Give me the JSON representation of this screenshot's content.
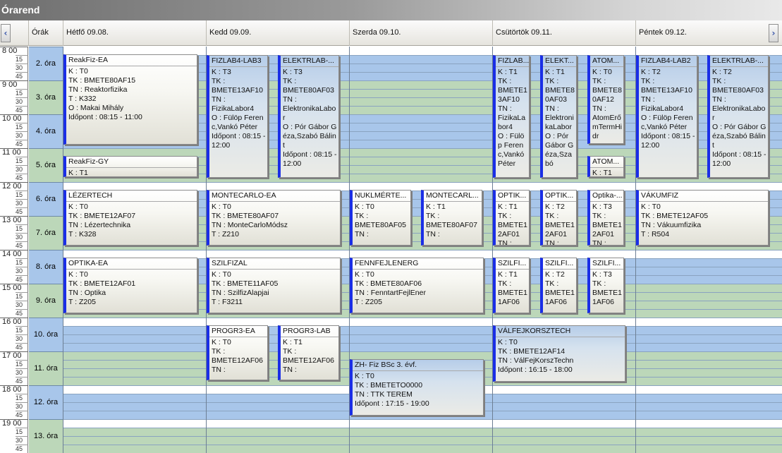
{
  "window": {
    "title": "Órarend"
  },
  "header": {
    "orak_label": "Órák",
    "days": [
      "Hétfő  09.08.",
      "Kedd  09.09.",
      "Szerda  09.10.",
      "Csütörtök  09.11.",
      "Péntek  09.12."
    ],
    "prev_icon": "chevron-left-icon",
    "next_icon": "chevron-right-icon"
  },
  "colors": {
    "blue_band": "#a8c6ea",
    "green_band": "#bcd7b9",
    "event_bar": "#1a2ee6"
  },
  "time": {
    "hours": [
      "8",
      "9",
      "10",
      "11",
      "12",
      "13",
      "14",
      "15",
      "16",
      "17",
      "18",
      "19"
    ],
    "minutes": [
      "15",
      "30",
      "45"
    ]
  },
  "periods": [
    "2. óra",
    "3. óra",
    "4. óra",
    "5. óra",
    "6. óra",
    "7. óra",
    "8. óra",
    "9. óra",
    "10. óra",
    "11. óra",
    "12. óra",
    "13. óra"
  ],
  "events": [
    {
      "title": "ReakFiz-EA",
      "lines": [
        "K : T0",
        "TK : BMETE80AF15",
        "TN : Reaktorfizika",
        "T : K332",
        "O : Makai Mihály",
        "Időpont : 08:15 - 11:00"
      ]
    },
    {
      "title": "ReakFiz-GY",
      "lines": [
        "K : T1"
      ]
    },
    {
      "title": "LÉZERTECH",
      "lines": [
        "K : T0",
        "TK : BMETE12AF07",
        "TN : Lézertechnika",
        "T : K328"
      ]
    },
    {
      "title": "OPTIKA-EA",
      "lines": [
        "K : T0",
        "TK : BMETE12AF01",
        "TN : Optika",
        "T : Z205"
      ]
    },
    {
      "title": "FIZLAB4-LAB3",
      "lines": [
        "K : T3",
        "TK :",
        "BMETE13AF10",
        "TN :",
        "FizikaLabor4",
        "O : Fülöp Ferenc,Vankó Péter",
        "Időpont : 08:15 - 12:00"
      ]
    },
    {
      "title": "ELEKTRLAB-...",
      "lines": [
        "K : T3",
        "TK :",
        "BMETE80AF03",
        "TN :",
        "ElektronikaLabor",
        "O : Pór Gábor Géza,Szabó Bálint",
        "Időpont : 08:15 - 12:00"
      ]
    },
    {
      "title": "MONTECARLO-EA",
      "lines": [
        "K : T0",
        "TK : BMETE80AF07",
        "TN : MonteCarloMódsz",
        "T : Z210"
      ]
    },
    {
      "title": "SZILFIZAL",
      "lines": [
        "K : T0",
        "TK : BMETE11AF05",
        "TN : SzilfizAlapjai",
        "T : F3211"
      ]
    },
    {
      "title": "PROGR3-EA",
      "lines": [
        "K : T0",
        "TK :",
        "BMETE12AF06",
        "TN :"
      ]
    },
    {
      "title": "PROGR3-LAB",
      "lines": [
        "K : T1",
        "TK :",
        "BMETE12AF06",
        "TN :"
      ]
    },
    {
      "title": "NUKLMÉRTE...",
      "lines": [
        "K : T0",
        "TK :",
        "BMETE80AF05",
        "TN :"
      ]
    },
    {
      "title": "MONTECARL...",
      "lines": [
        "K : T1",
        "TK :",
        "BMETE80AF07",
        "TN :"
      ]
    },
    {
      "title": "FENNFEJLENERG",
      "lines": [
        "K : T0",
        "TK : BMETE80AF06",
        "TN : FenntartFejlEner",
        "T : Z205"
      ]
    },
    {
      "title": "ZH- Fiz BSc 3. évf.",
      "lines": [
        "K : T0",
        "TK : BMETETO0000",
        "TN : TTK TEREM",
        "Időpont : 17:15 - 19:00"
      ]
    },
    {
      "title": "FIZLAB...",
      "lines": [
        "K : T1",
        "TK :",
        "BMETE13AF10",
        "TN :",
        "FizikaLabor4",
        "O : Fülöp Ferenc,Vankó Péter"
      ]
    },
    {
      "title": "ELEKT...",
      "lines": [
        "K : T1",
        "TK :",
        "BMETE80AF03",
        "TN :",
        "ElektronikaLabor",
        "O : Pór Gábor Géza,Szabó"
      ]
    },
    {
      "title": "ATOM...",
      "lines": [
        "K : T0",
        "TK :",
        "BMETE80AF12",
        "TN :",
        "AtomErőmTermHidr"
      ]
    },
    {
      "title": "ATOM...",
      "lines": [
        "K : T1"
      ]
    },
    {
      "title": "OPTIK...",
      "lines": [
        "K : T1",
        "TK :",
        "BMETE12AF01",
        "TN :"
      ]
    },
    {
      "title": "OPTIK...",
      "lines": [
        "K : T2",
        "TK :",
        "BMETE12AF01",
        "TN :"
      ]
    },
    {
      "title": "Optika-...",
      "lines": [
        "K : T3",
        "TK :",
        "BMETE12AF01",
        "TN :"
      ]
    },
    {
      "title": "SZILFI...",
      "lines": [
        "K : T1",
        "TK :",
        "BMETE11AF06"
      ]
    },
    {
      "title": "SZILFI...",
      "lines": [
        "K : T2",
        "TK :",
        "BMETE11AF06"
      ]
    },
    {
      "title": "SZILFI...",
      "lines": [
        "K : T3",
        "TK :",
        "BMETE11AF06"
      ]
    },
    {
      "title": "VÁLFEJKORSZTECH",
      "lines": [
        "K : T0",
        "TK : BMETE12AF14",
        "TN : VálFejKorszTechn",
        "Időpont : 16:15 - 18:00"
      ]
    },
    {
      "title": "FIZLAB4-LAB2",
      "lines": [
        "K : T2",
        "TK :",
        "BMETE13AF10",
        "TN :",
        "FizikaLabor4",
        "O : Fülöp Ferenc,Vankó Péter",
        "Időpont : 08:15 - 12:00"
      ]
    },
    {
      "title": "ELEKTRLAB-...",
      "lines": [
        "K : T2",
        "TK :",
        "BMETE80AF03",
        "TN :",
        "ElektronikaLabor",
        "O : Pór Gábor Géza,Szabó Bálint",
        "Időpont : 08:15 - 12:00"
      ]
    },
    {
      "title": "VÁKUMFIZ",
      "lines": [
        "K : T0",
        "TK : BMETE12AF05",
        "TN : Vákuumfizika",
        "T : R504"
      ]
    }
  ]
}
